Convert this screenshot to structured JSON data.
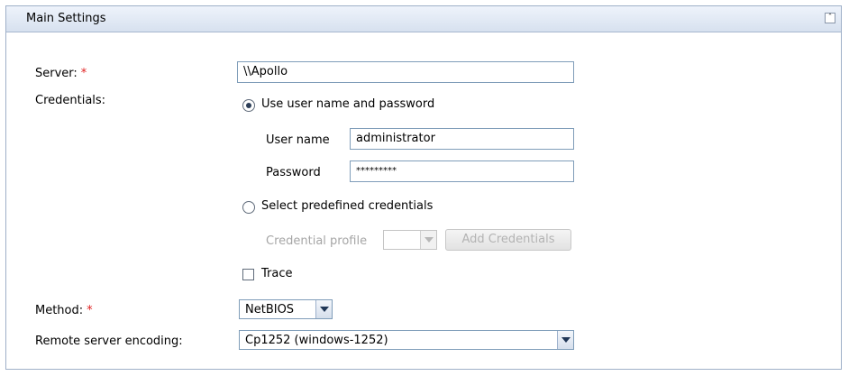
{
  "panel": {
    "title": "Main Settings",
    "collapse_icon": "double-chevron-up-icon"
  },
  "server": {
    "label": "Server:",
    "required_mark": "*",
    "value": "\\\\Apollo"
  },
  "credentials": {
    "label": "Credentials:",
    "use_user_pass_label": "Use user name and password",
    "username_label": "User name",
    "username_value": "administrator",
    "password_label": "Password",
    "password_value": "*********",
    "predefined_label": "Select predefined credentials",
    "profile_label": "Credential profile",
    "profile_value": "",
    "add_button": "Add Credentials",
    "selected": "use_user_pass"
  },
  "trace": {
    "label": "Trace",
    "checked": false
  },
  "method": {
    "label": "Method:",
    "required_mark": "*",
    "value": "NetBIOS"
  },
  "encoding": {
    "label": "Remote server encoding:",
    "value": "Cp1252 (windows-1252)"
  }
}
